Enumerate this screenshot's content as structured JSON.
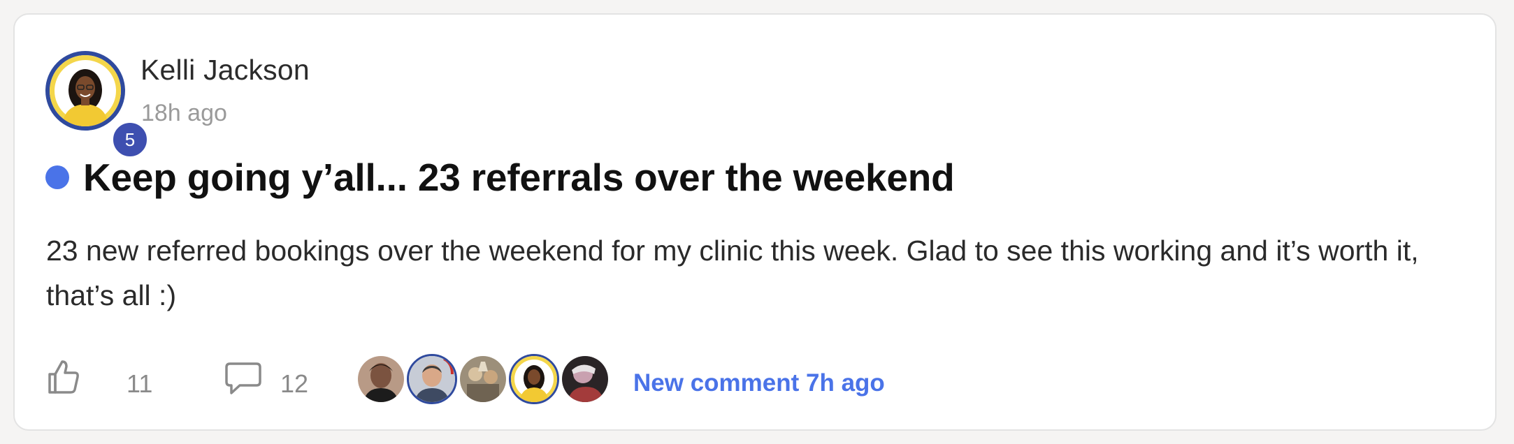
{
  "post": {
    "author": {
      "name": "Kelli Jackson",
      "level": "5",
      "time_ago": "18h ago"
    },
    "title": "Keep going y’all... 23 referrals over the weekend",
    "body": "23 new referred bookings over the weekend for my clinic this week. Glad to see this working and it’s worth it, that’s all :)",
    "likes": "11",
    "comments": "12",
    "new_comment_text": "New comment 7h ago"
  },
  "colors": {
    "accent": "#4a73e8",
    "level_badge": "#3e4fb0",
    "avatar_ring": "#2f4a9e"
  },
  "icons": {
    "like": "thumbs-up-icon",
    "comment": "speech-bubble-icon"
  }
}
